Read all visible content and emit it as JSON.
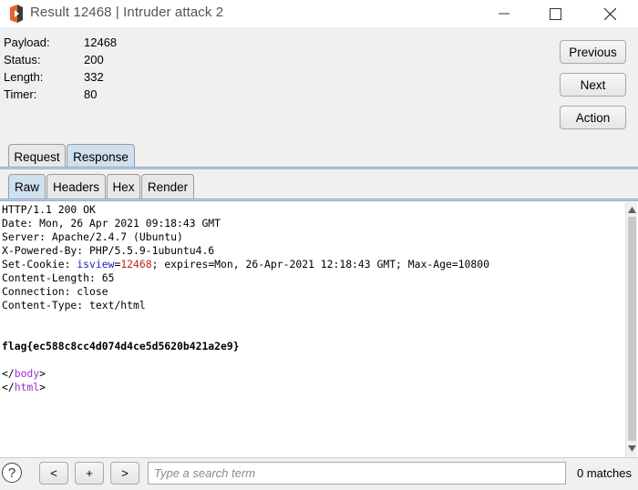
{
  "window": {
    "title": "Result 12468 | Intruder attack 2",
    "icons": [
      "app-icon",
      "minimize-icon",
      "maximize-icon",
      "close-icon"
    ]
  },
  "info": {
    "payload_label": "Payload:",
    "payload_value": "12468",
    "status_label": "Status:",
    "status_value": "200",
    "length_label": "Length:",
    "length_value": "332",
    "timer_label": "Timer:",
    "timer_value": "80"
  },
  "nav": {
    "previous": "Previous",
    "next": "Next",
    "action": "Action"
  },
  "tabs": [
    {
      "label": "Request",
      "active": false
    },
    {
      "label": "Response",
      "active": true
    }
  ],
  "subtabs": [
    {
      "label": "Raw",
      "active": true
    },
    {
      "label": "Headers",
      "active": false
    },
    {
      "label": "Hex",
      "active": false
    },
    {
      "label": "Render",
      "active": false
    }
  ],
  "response": {
    "status_line": "HTTP/1.1 200 OK",
    "date_line": "Date: Mon, 26 Apr 2021 09:18:43 GMT",
    "server_line": "Server: Apache/2.4.7 (Ubuntu)",
    "powered_line": "X-Powered-By: PHP/5.5.9-1ubuntu4.6",
    "cookie_prefix": "Set-Cookie: ",
    "cookie_name": "isview",
    "cookie_eq": "=",
    "cookie_value": "12468",
    "cookie_suffix": "; expires=Mon, 26-Apr-2021 12:18:43 GMT; Max-Age=10800",
    "content_length_line": "Content-Length: 65",
    "connection_line": "Connection: close",
    "content_type_line": "Content-Type: text/html",
    "flag_line": "flag{ec588c8cc4d074d4ce5d5620b421a2e9}",
    "body_open": "</",
    "body_tag": "body",
    "body_close": ">",
    "html_open": "</",
    "html_tag": "html",
    "html_close": ">"
  },
  "colors": {
    "tag": "#9b30c8",
    "cookie_name": "#2020c0",
    "cookie_value": "#c02020",
    "active_tab": "#cfe0ef"
  },
  "bottom": {
    "help": "?",
    "prev": "<",
    "add": "+",
    "next": ">",
    "search_placeholder": "Type a search term",
    "matches": "0 matches"
  }
}
